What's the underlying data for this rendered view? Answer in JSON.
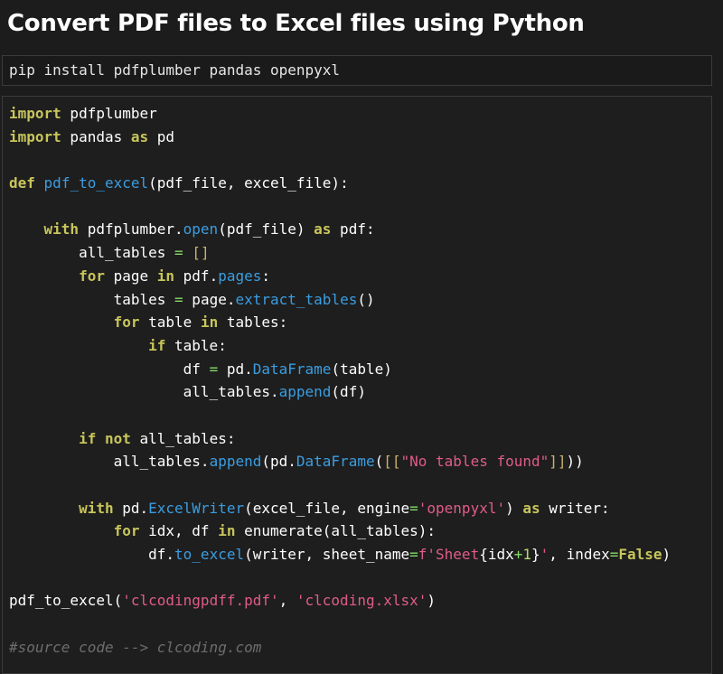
{
  "page": {
    "title": "Convert PDF files to Excel files using Python"
  },
  "install": {
    "command": "pip install pdfplumber pandas openpyxl"
  },
  "code": {
    "language": "python",
    "lines": [
      [
        {
          "t": "kw",
          "v": "import"
        },
        {
          "t": "plain",
          "v": " pdfplumber"
        }
      ],
      [
        {
          "t": "kw",
          "v": "import"
        },
        {
          "t": "plain",
          "v": " pandas "
        },
        {
          "t": "kw",
          "v": "as"
        },
        {
          "t": "plain",
          "v": " pd"
        }
      ],
      [],
      [
        {
          "t": "kw",
          "v": "def"
        },
        {
          "t": "plain",
          "v": " "
        },
        {
          "t": "fn",
          "v": "pdf_to_excel"
        },
        {
          "t": "plain",
          "v": "(pdf_file, excel_file):"
        }
      ],
      [],
      [
        {
          "t": "plain",
          "v": "    "
        },
        {
          "t": "kw",
          "v": "with"
        },
        {
          "t": "plain",
          "v": " pdfplumber."
        },
        {
          "t": "fn",
          "v": "open"
        },
        {
          "t": "plain",
          "v": "(pdf_file) "
        },
        {
          "t": "kw",
          "v": "as"
        },
        {
          "t": "plain",
          "v": " pdf:"
        }
      ],
      [
        {
          "t": "plain",
          "v": "        all_tables "
        },
        {
          "t": "op",
          "v": "="
        },
        {
          "t": "plain",
          "v": " "
        },
        {
          "t": "brk",
          "v": "[]"
        }
      ],
      [
        {
          "t": "plain",
          "v": "        "
        },
        {
          "t": "kw",
          "v": "for"
        },
        {
          "t": "plain",
          "v": " page "
        },
        {
          "t": "kw",
          "v": "in"
        },
        {
          "t": "plain",
          "v": " pdf."
        },
        {
          "t": "fn",
          "v": "pages"
        },
        {
          "t": "plain",
          "v": ":"
        }
      ],
      [
        {
          "t": "plain",
          "v": "            tables "
        },
        {
          "t": "op",
          "v": "="
        },
        {
          "t": "plain",
          "v": " page."
        },
        {
          "t": "fn",
          "v": "extract_tables"
        },
        {
          "t": "plain",
          "v": "()"
        }
      ],
      [
        {
          "t": "plain",
          "v": "            "
        },
        {
          "t": "kw",
          "v": "for"
        },
        {
          "t": "plain",
          "v": " table "
        },
        {
          "t": "kw",
          "v": "in"
        },
        {
          "t": "plain",
          "v": " tables:"
        }
      ],
      [
        {
          "t": "plain",
          "v": "                "
        },
        {
          "t": "kw",
          "v": "if"
        },
        {
          "t": "plain",
          "v": " table:"
        }
      ],
      [
        {
          "t": "plain",
          "v": "                    df "
        },
        {
          "t": "op",
          "v": "="
        },
        {
          "t": "plain",
          "v": " pd."
        },
        {
          "t": "fn",
          "v": "DataFrame"
        },
        {
          "t": "plain",
          "v": "(table)"
        }
      ],
      [
        {
          "t": "plain",
          "v": "                    all_tables."
        },
        {
          "t": "fn",
          "v": "append"
        },
        {
          "t": "plain",
          "v": "(df)"
        }
      ],
      [],
      [
        {
          "t": "plain",
          "v": "        "
        },
        {
          "t": "kw",
          "v": "if"
        },
        {
          "t": "plain",
          "v": " "
        },
        {
          "t": "kw",
          "v": "not"
        },
        {
          "t": "plain",
          "v": " all_tables:"
        }
      ],
      [
        {
          "t": "plain",
          "v": "            all_tables."
        },
        {
          "t": "fn",
          "v": "append"
        },
        {
          "t": "plain",
          "v": "(pd."
        },
        {
          "t": "fn",
          "v": "DataFrame"
        },
        {
          "t": "plain",
          "v": "("
        },
        {
          "t": "brk",
          "v": "[["
        },
        {
          "t": "str",
          "v": "\"No tables found\""
        },
        {
          "t": "brk",
          "v": "]]"
        },
        {
          "t": "plain",
          "v": "))"
        }
      ],
      [],
      [
        {
          "t": "plain",
          "v": "        "
        },
        {
          "t": "kw",
          "v": "with"
        },
        {
          "t": "plain",
          "v": " pd."
        },
        {
          "t": "fn",
          "v": "ExcelWriter"
        },
        {
          "t": "plain",
          "v": "(excel_file, engine"
        },
        {
          "t": "op",
          "v": "="
        },
        {
          "t": "str",
          "v": "'openpyxl'"
        },
        {
          "t": "plain",
          "v": ") "
        },
        {
          "t": "kw",
          "v": "as"
        },
        {
          "t": "plain",
          "v": " writer:"
        }
      ],
      [
        {
          "t": "plain",
          "v": "            "
        },
        {
          "t": "kw",
          "v": "for"
        },
        {
          "t": "plain",
          "v": " idx, df "
        },
        {
          "t": "kw",
          "v": "in"
        },
        {
          "t": "plain",
          "v": " enumerate(all_tables):"
        }
      ],
      [
        {
          "t": "plain",
          "v": "                df."
        },
        {
          "t": "fn",
          "v": "to_excel"
        },
        {
          "t": "plain",
          "v": "(writer, sheet_name"
        },
        {
          "t": "op",
          "v": "="
        },
        {
          "t": "str",
          "v": "f'Sheet"
        },
        {
          "t": "plain",
          "v": "{idx"
        },
        {
          "t": "op",
          "v": "+"
        },
        {
          "t": "num",
          "v": "1"
        },
        {
          "t": "plain",
          "v": "}"
        },
        {
          "t": "str",
          "v": "'"
        },
        {
          "t": "plain",
          "v": ", index"
        },
        {
          "t": "op",
          "v": "="
        },
        {
          "t": "kw",
          "v": "False"
        },
        {
          "t": "plain",
          "v": ")"
        }
      ],
      [],
      [
        {
          "t": "plain",
          "v": "pdf_to_excel("
        },
        {
          "t": "str",
          "v": "'clcodingpdff.pdf'"
        },
        {
          "t": "plain",
          "v": ", "
        },
        {
          "t": "str",
          "v": "'clcoding.xlsx'"
        },
        {
          "t": "plain",
          "v": ")"
        }
      ],
      [],
      [
        {
          "t": "cmt",
          "v": "#source code --> clcoding.com"
        }
      ]
    ]
  },
  "colors": {
    "background": "#1c1c1c",
    "keyword": "#c8c55b",
    "function": "#3b9de1",
    "string": "#e05c87",
    "number": "#b7d96a",
    "operator": "#86d96a",
    "comment": "#6d6d6d"
  }
}
